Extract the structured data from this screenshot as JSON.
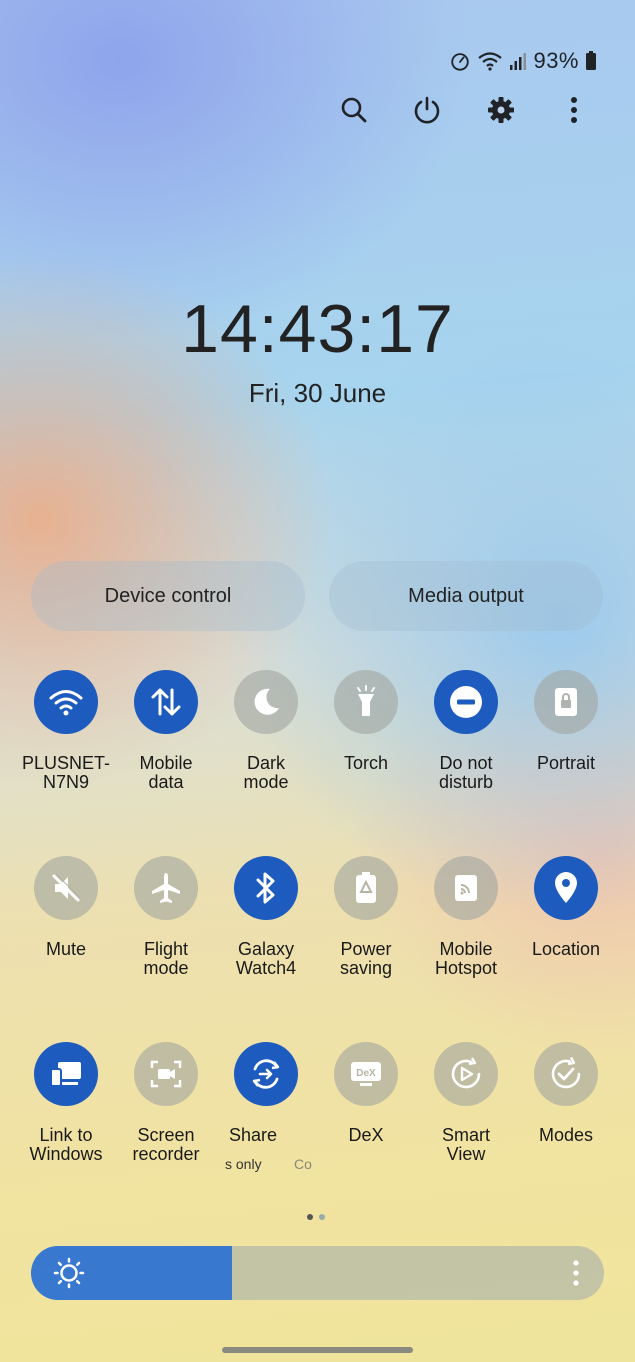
{
  "status": {
    "battery_pct": "93%"
  },
  "toolbar": {
    "search": "search-icon",
    "power": "power-icon",
    "settings": "gear-icon",
    "more": "more-vert-icon"
  },
  "clock": {
    "time": "14:43:17",
    "date": "Fri, 30 June"
  },
  "buttons": {
    "device_control": "Device control",
    "media_output": "Media output"
  },
  "tiles": [
    {
      "label": "PLUSNET-\nN7N9",
      "icon": "wifi-icon",
      "on": true
    },
    {
      "label": "Mobile\ndata",
      "icon": "data-arrows-icon",
      "on": true
    },
    {
      "label": "Dark\nmode",
      "icon": "moon-icon",
      "on": false
    },
    {
      "label": "Torch",
      "icon": "flashlight-icon",
      "on": false
    },
    {
      "label": "Do not\ndisturb",
      "icon": "minus-circle-icon",
      "on": true
    },
    {
      "label": "Portrait",
      "icon": "portrait-lock-icon",
      "on": false
    },
    {
      "label": "Mute",
      "icon": "muted-speaker-icon",
      "on": false
    },
    {
      "label": "Flight\nmode",
      "icon": "airplane-icon",
      "on": false
    },
    {
      "label": "Galaxy\nWatch4",
      "icon": "bluetooth-icon",
      "on": true
    },
    {
      "label": "Power\nsaving",
      "icon": "battery-leaf-icon",
      "on": false
    },
    {
      "label": "Mobile\nHotspot",
      "icon": "hotspot-icon",
      "on": false
    },
    {
      "label": "Location",
      "icon": "location-pin-icon",
      "on": true
    },
    {
      "label": "Link to\nWindows",
      "icon": "link-to-windows-icon",
      "on": true
    },
    {
      "label": "Screen\nrecorder",
      "icon": "screen-recorder-icon",
      "on": false
    },
    {
      "label": "Share",
      "icon": "quick-share-icon",
      "on": true
    },
    {
      "label": "DeX",
      "icon": "dex-icon",
      "on": false
    },
    {
      "label": "Smart\nView",
      "icon": "smart-view-icon",
      "on": false
    },
    {
      "label": "Modes",
      "icon": "modes-icon",
      "on": false
    }
  ],
  "share_sub": {
    "left": "s only",
    "right": "Co"
  },
  "brightness": {
    "level": 0.35
  },
  "colors": {
    "accent": "#1e5bbf",
    "slider": "#3878cf"
  }
}
